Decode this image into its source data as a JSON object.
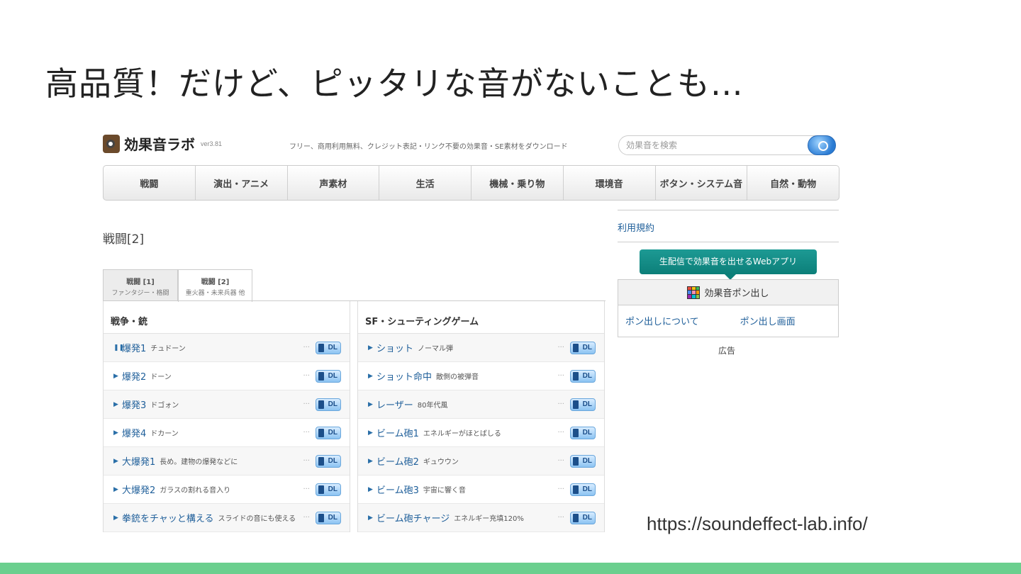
{
  "slide": {
    "title": "高品質！だけど、ピッタリな音がないことも…",
    "url": "https://soundeffect-lab.info/",
    "accent_color": "#6bcf8e"
  },
  "site": {
    "logo_text": "効果音ラボ",
    "version": "ver3.81",
    "tagline": "フリー、商用利用無料、クレジット表記・リンク不要の効果音・SE素材をダウンロード",
    "search_placeholder": "効果音を検索"
  },
  "nav": [
    "戦闘",
    "演出・アニメ",
    "声素材",
    "生活",
    "機械・乗り物",
    "環境音",
    "ボタン・システム音",
    "自然・動物"
  ],
  "section_title": "戦闘[2]",
  "tabs": [
    {
      "title": "戦闘 [1]",
      "sub": "ファンタジー・格闘"
    },
    {
      "title": "戦闘 [2]",
      "sub": "重火器・未来兵器 他"
    }
  ],
  "columns": [
    {
      "heading": "戦争・銃",
      "rows": [
        {
          "icon": "pause-icon",
          "glyph": "❚❚",
          "name": "爆発1",
          "desc": "チュドーン"
        },
        {
          "icon": "play-icon",
          "glyph": "▶",
          "name": "爆発2",
          "desc": "ドーン"
        },
        {
          "icon": "play-icon",
          "glyph": "▶",
          "name": "爆発3",
          "desc": "ドゴォン"
        },
        {
          "icon": "play-icon",
          "glyph": "▶",
          "name": "爆発4",
          "desc": "ドカーン"
        },
        {
          "icon": "play-icon",
          "glyph": "▶",
          "name": "大爆発1",
          "desc": "長め。建物の爆発などに"
        },
        {
          "icon": "play-icon",
          "glyph": "▶",
          "name": "大爆発2",
          "desc": "ガラスの割れる音入り"
        },
        {
          "icon": "play-icon",
          "glyph": "▶",
          "name": "拳銃をチャッと構える",
          "desc": "スライドの音にも使える"
        }
      ]
    },
    {
      "heading": "SF・シューティングゲーム",
      "rows": [
        {
          "icon": "play-icon",
          "glyph": "▶",
          "name": "ショット",
          "desc": "ノーマル弾"
        },
        {
          "icon": "play-icon",
          "glyph": "▶",
          "name": "ショット命中",
          "desc": "敵側の被弾音"
        },
        {
          "icon": "play-icon",
          "glyph": "▶",
          "name": "レーザー",
          "desc": "80年代風"
        },
        {
          "icon": "play-icon",
          "glyph": "▶",
          "name": "ビーム砲1",
          "desc": "エネルギーがほとばしる"
        },
        {
          "icon": "play-icon",
          "glyph": "▶",
          "name": "ビーム砲2",
          "desc": "ギュウウン"
        },
        {
          "icon": "play-icon",
          "glyph": "▶",
          "name": "ビーム砲3",
          "desc": "宇宙に響く音"
        },
        {
          "icon": "play-icon",
          "glyph": "▶",
          "name": "ビーム砲チャージ",
          "desc": "エネルギー充填120%"
        }
      ]
    }
  ],
  "dl_label": "DL",
  "dots": "···",
  "sidebar": {
    "terms_link": "利用規約",
    "bubble_text": "生配信で効果音を出せるWebアプリ",
    "pon_title": "効果音ポン出し",
    "pon_links": [
      "ポン出しについて",
      "ポン出し画面"
    ],
    "ad_label": "広告",
    "bubble_color": "#0c7f79"
  }
}
